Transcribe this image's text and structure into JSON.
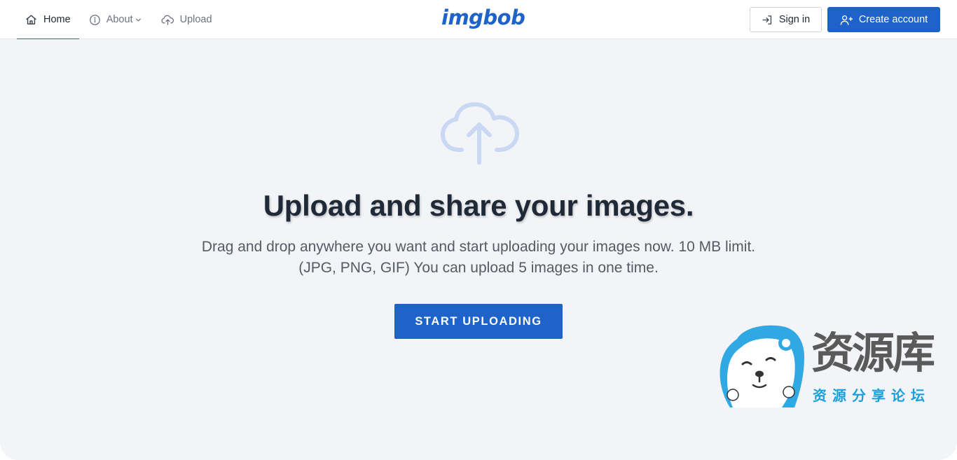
{
  "nav": {
    "home": {
      "label": "Home",
      "icon": "home-icon"
    },
    "about": {
      "label": "About",
      "icon": "info-icon"
    },
    "upload": {
      "label": "Upload",
      "icon": "cloud-upload-icon"
    }
  },
  "logo": {
    "text": "imgbob"
  },
  "auth": {
    "signin_label": "Sign in",
    "signin_icon": "sign-in-icon",
    "create_label": "Create account",
    "create_icon": "user-plus-icon"
  },
  "hero": {
    "icon": "cloud-upload-icon",
    "headline": "Upload and share your images.",
    "line1": "Drag and drop anywhere you want and start uploading your images now. 10 MB limit.",
    "line2": "(JPG, PNG, GIF) You can upload 5 images in one time.",
    "cta_label": "START UPLOADING"
  },
  "watermark": {
    "title": "资源库",
    "subtitle": "资源分享论坛"
  },
  "colors": {
    "accent": "#1e63c9",
    "background": "#f3f4f7",
    "hero_icon": "#c9d9f3"
  }
}
